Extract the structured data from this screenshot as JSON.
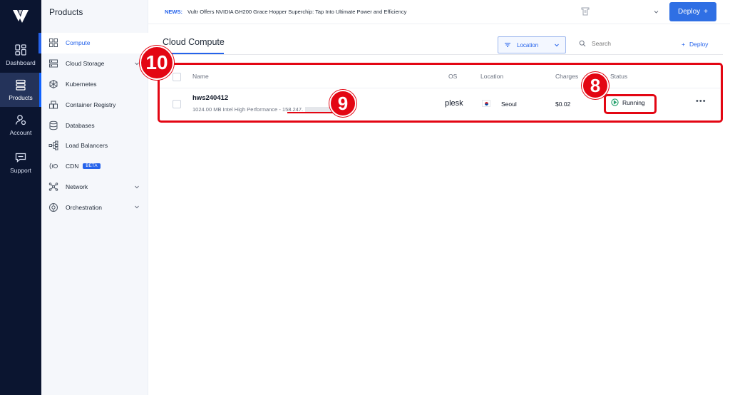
{
  "rail": {
    "items": [
      {
        "label": "Dashboard",
        "icon": "dashboard-icon"
      },
      {
        "label": "Products",
        "icon": "products-icon",
        "active": true
      },
      {
        "label": "Account",
        "icon": "account-icon"
      },
      {
        "label": "Support",
        "icon": "support-icon"
      }
    ]
  },
  "products_panel": {
    "title": "Products",
    "items": [
      {
        "label": "Compute",
        "active": true
      },
      {
        "label": "Cloud Storage",
        "has_chevron": true
      },
      {
        "label": "Kubernetes"
      },
      {
        "label": "Container Registry"
      },
      {
        "label": "Databases"
      },
      {
        "label": "Load Balancers"
      },
      {
        "label": "CDN",
        "badge": "BETA"
      },
      {
        "label": "Network",
        "has_chevron": true
      },
      {
        "label": "Orchestration",
        "has_chevron": true
      }
    ]
  },
  "topbar": {
    "news_label": "NEWS:",
    "news_text": "Vultr Offers NVIDIA GH200 Grace Hopper Superchip: Tap Into Ultimate Power and Efficiency",
    "deploy_label": "Deploy",
    "deploy_plus": "+"
  },
  "page": {
    "title": "Cloud Compute",
    "location_label": "Location",
    "search_placeholder": "Search",
    "deploy_link_label": "Deploy",
    "deploy_link_plus": "+"
  },
  "table": {
    "headers": {
      "name": "Name",
      "os": "OS",
      "location": "Location",
      "charges": "Charges",
      "status": "Status"
    },
    "rows": [
      {
        "name": "hws240412",
        "subtitle": "1024.00 MB Intel High Performance - 158.247.",
        "os": "plesk",
        "location": "Seoul",
        "charges": "$0.02",
        "status": "Running",
        "more": "•••"
      }
    ]
  },
  "annotations": {
    "badge_table": "10",
    "badge_ip": "9",
    "badge_status": "8"
  },
  "colors": {
    "accent": "#2563eb",
    "annotation_red": "#e30613",
    "status_green": "#22a06b",
    "rail_bg": "#0b1530"
  }
}
